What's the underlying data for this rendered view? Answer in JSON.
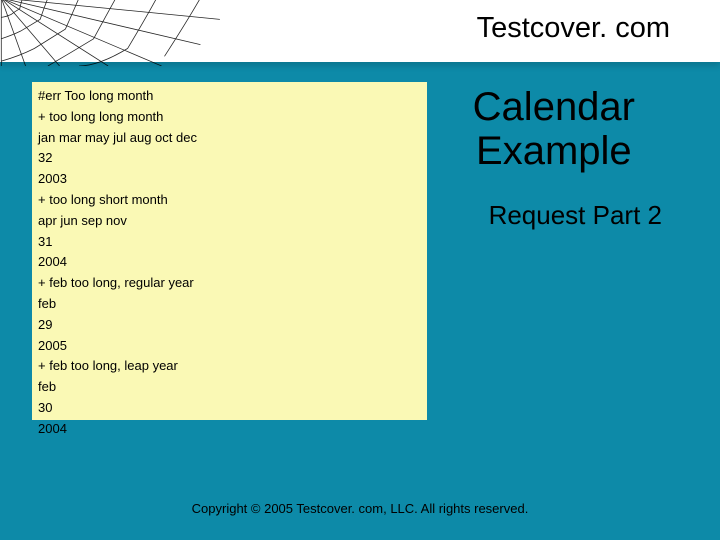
{
  "brand": "Testcover. com",
  "title_line1": "Calendar",
  "title_line2": "Example",
  "subtitle": "Request Part 2",
  "footer": "Copyright © 2005 Testcover. com, LLC. All rights reserved.",
  "code_lines": [
    "#err Too long month",
    "+ too long long month",
    "jan mar may jul aug oct dec",
    "32",
    "2003",
    "+ too long short month",
    "apr jun sep nov",
    "31",
    "2004",
    "+ feb too long, regular year",
    "feb",
    "29",
    "2005",
    "+ feb too long, leap year",
    "feb",
    "30",
    "2004"
  ]
}
